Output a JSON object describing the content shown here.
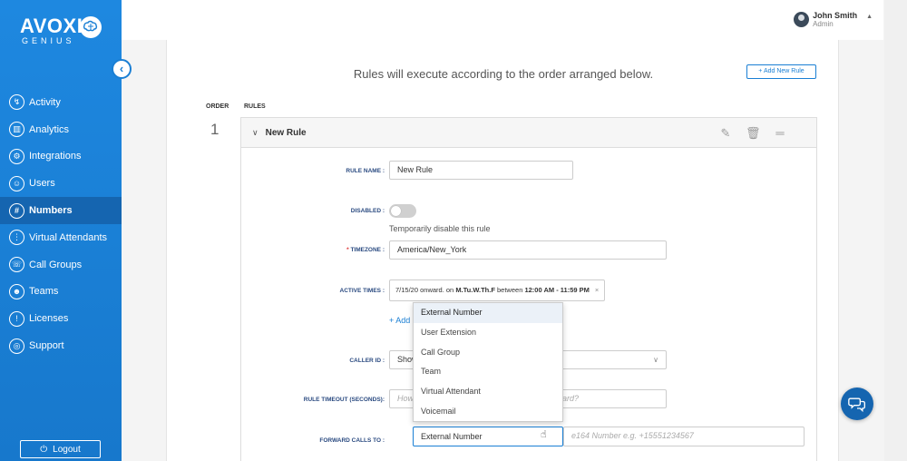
{
  "brand": {
    "name": "AVOXI",
    "sub": "GENIUS"
  },
  "nav": [
    {
      "label": "Activity",
      "icon": "activity-icon",
      "glyph": "↯"
    },
    {
      "label": "Analytics",
      "icon": "analytics-icon",
      "glyph": "▥"
    },
    {
      "label": "Integrations",
      "icon": "integrations-icon",
      "glyph": "⚙"
    },
    {
      "label": "Users",
      "icon": "users-icon",
      "glyph": "☺"
    },
    {
      "label": "Numbers",
      "icon": "numbers-icon",
      "glyph": "#",
      "active": true
    },
    {
      "label": "Virtual Attendants",
      "icon": "virtual-attendants-icon",
      "glyph": "⋮"
    },
    {
      "label": "Call Groups",
      "icon": "call-groups-icon",
      "glyph": "☏"
    },
    {
      "label": "Teams",
      "icon": "teams-icon",
      "glyph": "☻"
    },
    {
      "label": "Licenses",
      "icon": "licenses-icon",
      "glyph": "!"
    },
    {
      "label": "Support",
      "icon": "support-icon",
      "glyph": "◎"
    }
  ],
  "logout_label": "Logout",
  "user": {
    "name": "John Smith",
    "role": "Admin"
  },
  "headline": "Rules will execute according to the order arranged below.",
  "add_rule_label": "+ Add New Rule",
  "columns": {
    "order": "ORDER",
    "rules": "RULES"
  },
  "rule": {
    "order": "1",
    "title": "New Rule",
    "labels": {
      "rule_name": "RULE NAME :",
      "disabled": "DISABLED :",
      "timezone": "TIMEZONE :",
      "active_times": "ACTIVE TIMES :",
      "caller_id": "CALLER ID :",
      "rule_timeout": "RULE TIMEOUT (SECONDS):",
      "forward_calls_to": "FORWARD CALLS TO :"
    },
    "rule_name_value": "New Rule",
    "disabled_help": "Temporarily disable this rule",
    "timezone_value": "America/New_York",
    "active_time": {
      "date": "7/15/20 onward. on ",
      "days": "M.Tu.W.Th.F",
      "between": " between ",
      "range": "12:00 AM - 11:59 PM"
    },
    "add_link": "+ Add",
    "caller_id_value": "Show",
    "timeout_placeholder": "How",
    "timeout_placeholder_tail": "ard?",
    "forward_value": "External Number",
    "number_placeholder": "e164 Number e.g. +15551234567"
  },
  "dropdown_options": [
    "External Number",
    "User Extension",
    "Call Group",
    "Team",
    "Virtual Attendant",
    "Voicemail"
  ],
  "colors": {
    "sidebar": "#1a7fd4",
    "accent": "#1a7fd4",
    "label": "#2a4a80"
  }
}
